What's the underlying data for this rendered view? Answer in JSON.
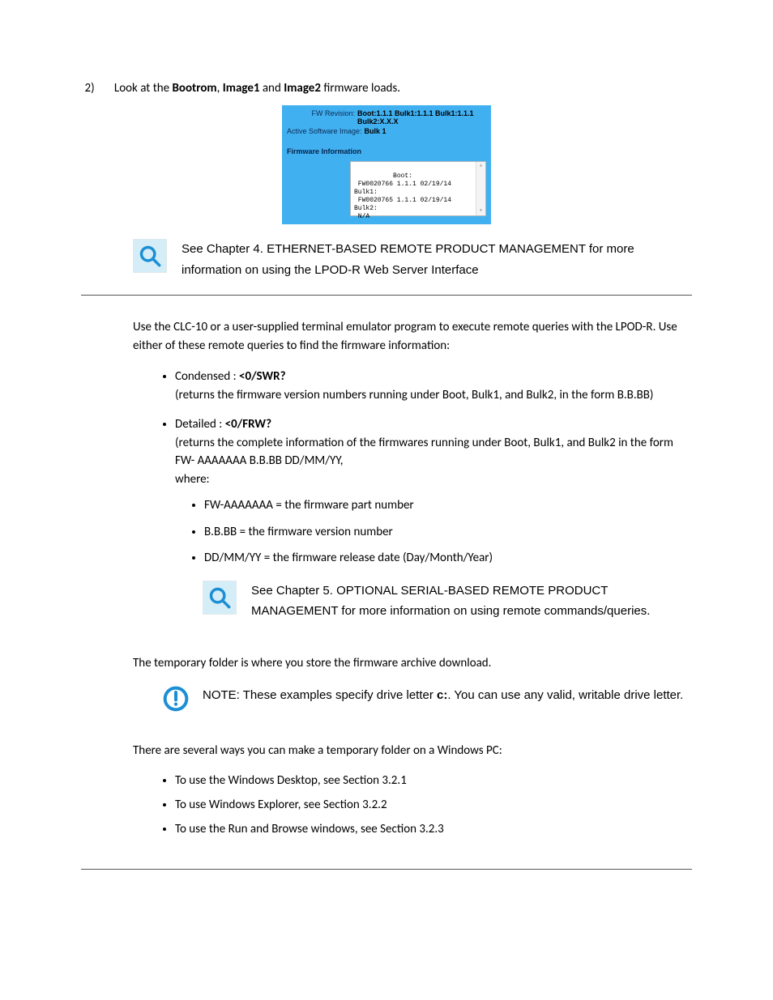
{
  "step": {
    "number": "2)",
    "pre": "Look at the ",
    "b1": "Bootrom",
    "sep1": ", ",
    "b2": "Image1",
    "sep2": " and ",
    "b3": "Image2",
    "post": " firmware loads."
  },
  "panel": {
    "fwrev_label": "FW Revision:",
    "fwrev_value": "Boot:1.1.1 Bulk1:1.1.1 Bulk1:1.1.1 Bulk2:X.X.X",
    "active_label": "Active Software Image:",
    "active_value": "Bulk 1",
    "section_title": "Firmware Information",
    "body": "Boot:\n FW0020766 1.1.1 02/19/14\nBulk1:\n FW0020765 1.1.1 02/19/14\nBulk2:\n N/A"
  },
  "callout1": "See Chapter 4. ETHERNET-BASED REMOTE PRODUCT MANAGEMENT for more information on using the LPOD-R Web Server Interface",
  "para_clc": "Use the CLC-10 or a user-supplied terminal emulator program to execute remote queries with the LPOD-R. Use either of these remote queries to find the firmware information:",
  "item_cond": {
    "lead": "Condensed : ",
    "cmd": "<0/SWR?",
    "desc": "(returns the firmware version numbers running under Boot, Bulk1, and Bulk2, in the form B.B.BB)"
  },
  "item_det": {
    "lead": "Detailed : ",
    "cmd": "<0/FRW?",
    "desc": "(returns the complete information of the firmwares running under Boot, Bulk1, and Bulk2 in the form FW- AAAAAAA B.B.BB DD/MM/YY,",
    "where": "where:",
    "sub1": "FW-AAAAAAA = the firmware part number",
    "sub2": "B.B.BB = the firmware version number",
    "sub3": "DD/MM/YY = the firmware release date (Day/Month/Year)"
  },
  "callout2": "See Chapter 5. OPTIONAL SERIAL-BASED REMOTE PRODUCT MANAGEMENT for more information on using remote commands/queries.",
  "para_temp": "The temporary folder is where you store the firmware archive download.",
  "note": {
    "lead": "NOTE:  These examples specify drive letter ",
    "drive": "c:",
    "tail": ". You can use any valid, writable drive letter."
  },
  "para_ways": "There are several ways you can make a temporary folder on a Windows PC:",
  "ways": {
    "w1": "To use the Windows Desktop, see Section 3.2.1",
    "w2": "To use Windows Explorer, see Section 3.2.2",
    "w3": "To use the Run and Browse windows, see Section 3.2.3"
  }
}
